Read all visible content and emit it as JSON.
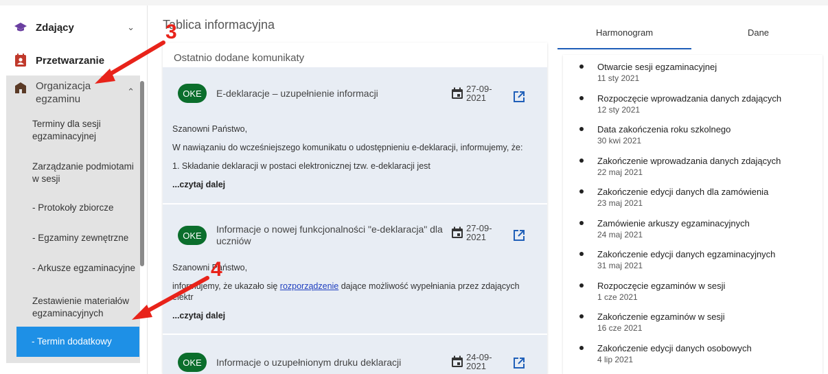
{
  "sidebar": {
    "items": [
      {
        "label": "Zdający",
        "icon": "graduation-cap-icon",
        "chevron": "chevron-down-icon"
      },
      {
        "label": "Przetwarzanie",
        "icon": "contact-card-icon"
      },
      {
        "label": "Organizacja egzaminu",
        "icon": "school-building-icon",
        "chevron": "chevron-up-icon"
      }
    ],
    "subitems": [
      "Terminy dla sesji egzaminacyjnej",
      "Zarządzanie podmiotami w sesji",
      "- Protokoły zbiorcze",
      "- Egzaminy zewnętrzne",
      "- Arkusze egzaminacyjne",
      "Zestawienie materiałów egzaminacyjnych",
      "- Termin dodatkowy"
    ]
  },
  "main": {
    "title": "Tablica informacyjna",
    "feed_title": "Ostatnio dodane komunikaty",
    "cards": [
      {
        "badge": "OKE",
        "title": "E-deklaracje – uzupełnienie informacji",
        "date_line1": "27-09-",
        "date_line2": "2021",
        "body": [
          "Szanowni Państwo,",
          "W nawiązaniu do wcześniejszego komunikatu o udostępnieniu e-deklaracji, informujemy, że:",
          "1. Składanie deklaracji w postaci elektronicznej tzw. e-deklaracji jest"
        ],
        "read_more": "...czytaj dalej"
      },
      {
        "badge": "OKE",
        "title": "Informacje o nowej funkcjonalności \"e-deklaracja\" dla uczniów",
        "date_line1": "27-09-",
        "date_line2": "2021",
        "body_greeting": "Szanowni Państwo,",
        "body_before_link": "informujemy, że ukazało się ",
        "body_link": "rozporządzenie",
        "body_after_link": " dające możliwość wypełniania przez zdających",
        "body_line3": "elektr",
        "read_more": "...czytaj dalej"
      },
      {
        "badge": "OKE",
        "title": "Informacje o uzupełnionym druku deklaracji",
        "date_line1": "24-09-",
        "date_line2": "2021"
      }
    ]
  },
  "right": {
    "tabs": [
      "Harmonogram",
      "Dane"
    ],
    "active_tab": "Harmonogram",
    "timeline": [
      {
        "title": "Otwarcie sesji egzaminacyjnej",
        "date": "11 sty 2021"
      },
      {
        "title": "Rozpoczęcie wprowadzania danych zdających",
        "date": "12 sty 2021"
      },
      {
        "title": "Data zakończenia roku szkolnego",
        "date": "30 kwi 2021"
      },
      {
        "title": "Zakończenie wprowadzania danych zdających",
        "date": "22 maj 2021"
      },
      {
        "title": "Zakończenie edycji danych dla zamówienia",
        "date": "23 maj 2021"
      },
      {
        "title": "Zamówienie arkuszy egzaminacyjnych",
        "date": "24 maj 2021"
      },
      {
        "title": "Zakończenie edycji danych egzaminacyjnych",
        "date": "31 maj 2021"
      },
      {
        "title": "Rozpoczęcie egzaminów w sesji",
        "date": "1 cze 2021"
      },
      {
        "title": "Zakończenie egzaminów w sesji",
        "date": "16 cze 2021"
      },
      {
        "title": "Zakończenie edycji danych osobowych",
        "date": "4 lip 2021"
      }
    ]
  },
  "annotations": {
    "marker_3": "3",
    "marker_4": "4"
  },
  "colors": {
    "accent": "#1e90e6",
    "badge": "#0b6e2c",
    "annotation": "#e8231a",
    "tab_underline": "#1e5db8"
  }
}
